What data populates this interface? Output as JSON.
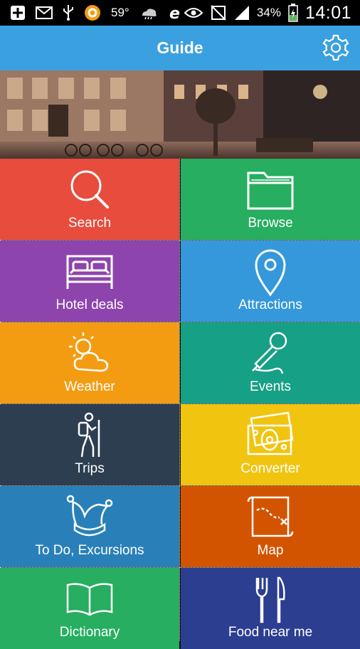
{
  "status_bar": {
    "temperature": "59°",
    "battery": "34%",
    "time": "14:01",
    "icons": [
      "add-icon",
      "mail-icon",
      "usb-icon",
      "app-icon",
      "weather-icon",
      "browser-icon",
      "eye-icon",
      "mute-icon",
      "signal-icon",
      "battery-icon"
    ]
  },
  "app_bar": {
    "title": "Guide",
    "settings_icon": "gear-icon"
  },
  "hero": {
    "image": "night-street-photo"
  },
  "tiles": [
    {
      "label": "Search",
      "color": "#e74c3c",
      "icon": "search-icon"
    },
    {
      "label": "Browse",
      "color": "#27ae60",
      "icon": "folder-icon"
    },
    {
      "label": "Hotel deals",
      "color": "#8e44ad",
      "icon": "bed-icon"
    },
    {
      "label": "Attractions",
      "color": "#3498db",
      "icon": "map-pin-icon"
    },
    {
      "label": "Weather",
      "color": "#f39c12",
      "icon": "weather-icon"
    },
    {
      "label": "Events",
      "color": "#16a085",
      "icon": "microphone-icon"
    },
    {
      "label": "Trips",
      "color": "#2c3e50",
      "icon": "hiker-icon"
    },
    {
      "label": "Converter",
      "color": "#f1c40f",
      "icon": "money-icon"
    },
    {
      "label": "To Do, Excursions",
      "color": "#2980b9",
      "icon": "jester-hat-icon"
    },
    {
      "label": "Map",
      "color": "#d35400",
      "icon": "treasure-map-icon"
    },
    {
      "label": "Dictionary",
      "color": "#27ae60",
      "icon": "book-icon"
    },
    {
      "label": "Food near me",
      "color": "#2c3e8f",
      "icon": "fork-knife-icon"
    }
  ]
}
